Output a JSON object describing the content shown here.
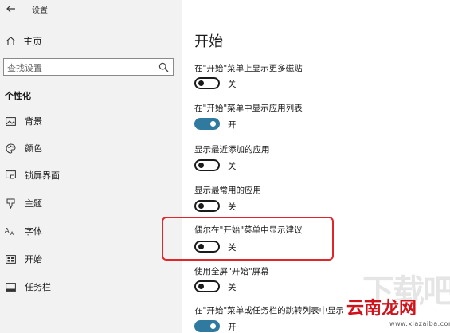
{
  "window": {
    "title": "设置"
  },
  "sidebar": {
    "home_label": "主页",
    "search_placeholder": "查找设置",
    "section_title": "个性化",
    "items": [
      {
        "label": "背景",
        "icon": "picture-icon"
      },
      {
        "label": "颜色",
        "icon": "palette-icon"
      },
      {
        "label": "锁屏界面",
        "icon": "lock-screen-icon"
      },
      {
        "label": "主题",
        "icon": "brush-icon"
      },
      {
        "label": "字体",
        "icon": "font-icon"
      },
      {
        "label": "开始",
        "icon": "start-icon"
      },
      {
        "label": "任务栏",
        "icon": "taskbar-icon"
      }
    ]
  },
  "main": {
    "title": "开始",
    "settings": [
      {
        "label": "在\"开始\"菜单上显示更多磁贴",
        "state": "关",
        "on": false
      },
      {
        "label": "在\"开始\"菜单中显示应用列表",
        "state": "开",
        "on": true
      },
      {
        "label": "显示最近添加的应用",
        "state": "关",
        "on": false
      },
      {
        "label": "显示最常用的应用",
        "state": "关",
        "on": false
      },
      {
        "label": "偶尔在\"开始\"菜单中显示建议",
        "state": "关",
        "on": false
      },
      {
        "label": "使用全屏\"开始\"屏幕",
        "state": "关",
        "on": false
      },
      {
        "label": "在\"开始\"菜单或任务栏的跳转列表中显示",
        "state": "开",
        "on": true
      }
    ]
  },
  "colors": {
    "accent": "#2f7a9e",
    "highlight": "#e0262b",
    "sidebar_bg": "#f2f2f2"
  },
  "watermark": {
    "big_text": "下载吧",
    "brand": "云南龙网",
    "url": "www.xiazaiba.com"
  }
}
